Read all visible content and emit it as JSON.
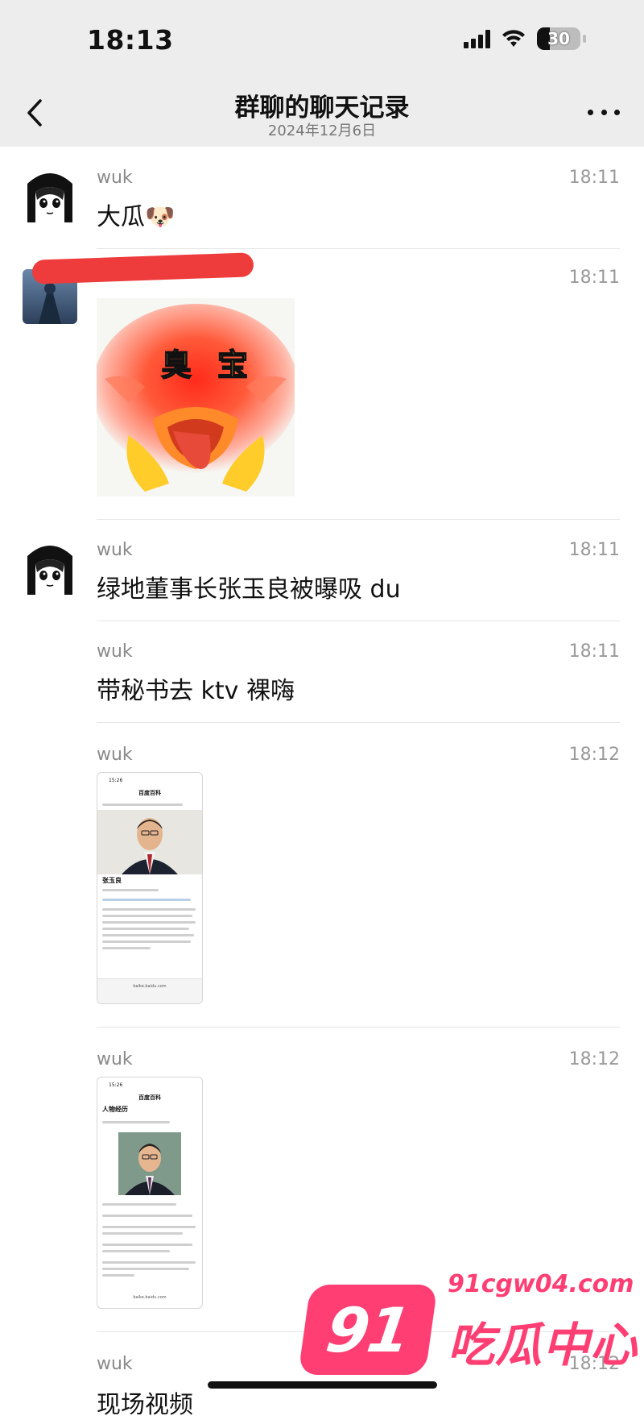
{
  "status_bar": {
    "time": "18:13",
    "battery": "30"
  },
  "header": {
    "title": "群聊的聊天记录",
    "date": "2024年12月6日"
  },
  "messages": [
    {
      "sender": "wuk",
      "time": "18:11",
      "text": "大瓜🐶"
    },
    {
      "sender": "",
      "time": "18:11",
      "sticker_text_1": "臭",
      "sticker_text_2": "宝"
    },
    {
      "sender": "wuk",
      "time": "18:11",
      "text": "绿地董事长张玉良被曝吸 du"
    },
    {
      "sender": "wuk",
      "time": "18:11",
      "text": "带秘书去 ktv 裸嗨"
    },
    {
      "sender": "wuk",
      "time": "18:12",
      "shot_time": "15:26",
      "shot_title": "百度百科",
      "shot_name": "张玉良",
      "shot_url": "baike.baidu.com"
    },
    {
      "sender": "wuk",
      "time": "18:12",
      "shot_time": "15:26",
      "shot_title": "百度百科",
      "shot_name": "人物经历",
      "shot_url": "baike.baidu.com"
    },
    {
      "sender": "wuk",
      "time": "18:12",
      "text": "现场视频"
    }
  ],
  "watermark": {
    "logo": "91",
    "domain": "91cgw04.com",
    "name": "吃瓜中心"
  }
}
